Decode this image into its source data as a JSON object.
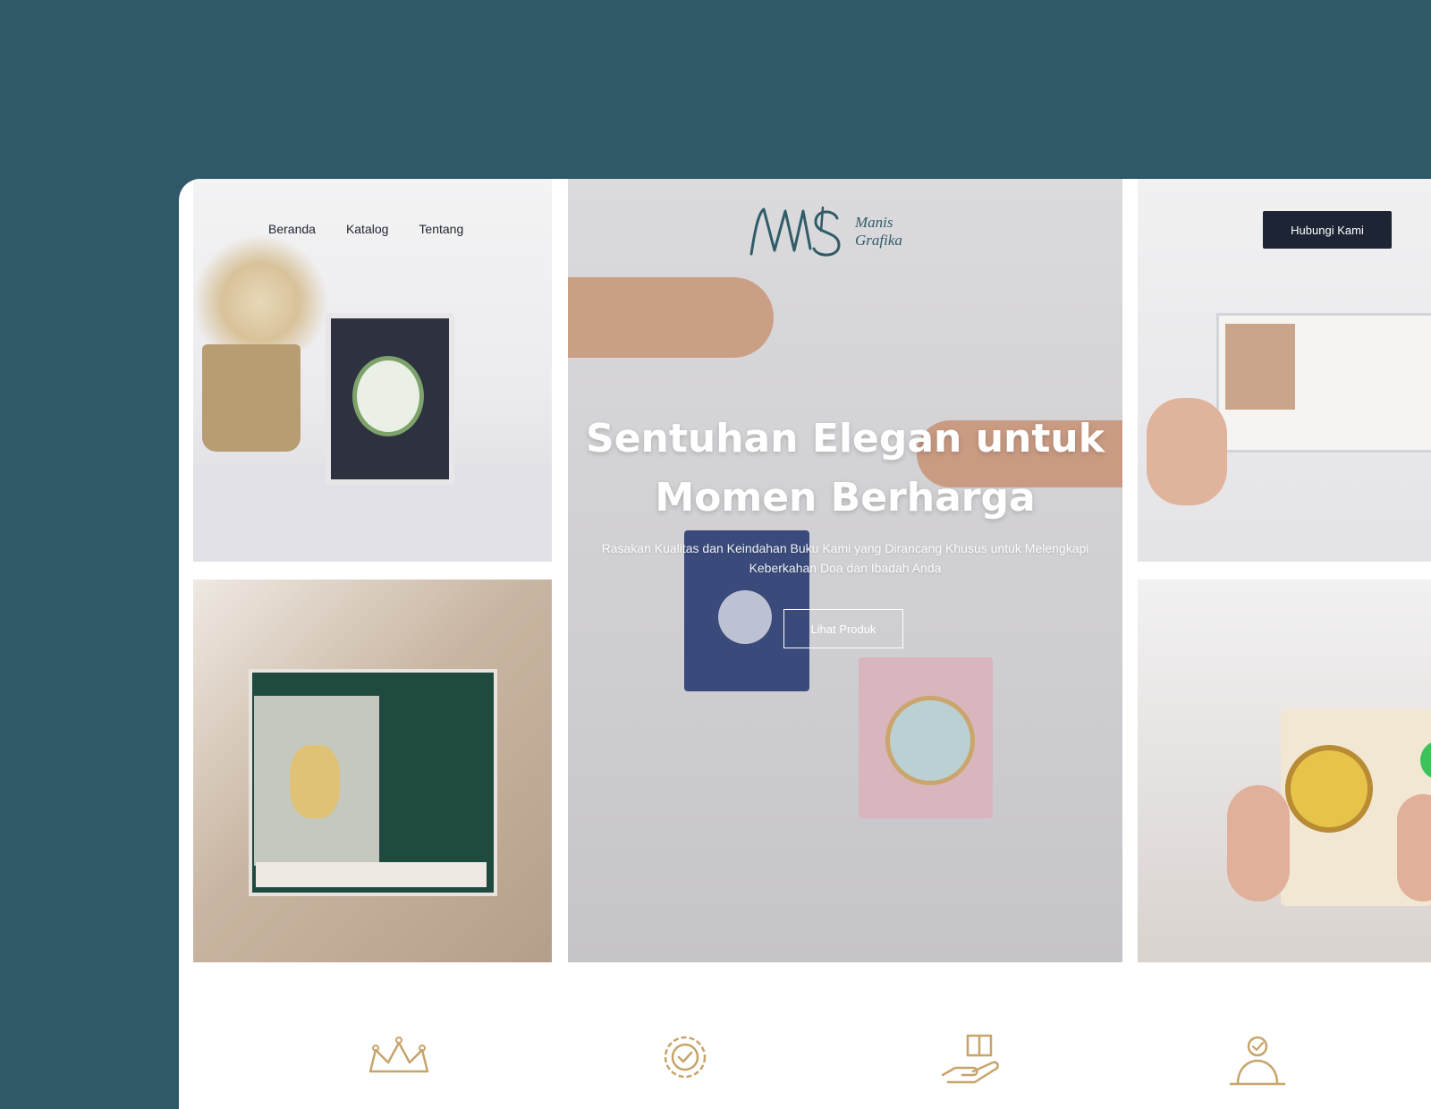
{
  "nav": {
    "items": [
      {
        "label": "Beranda"
      },
      {
        "label": "Katalog"
      },
      {
        "label": "Tentang"
      }
    ]
  },
  "brand": {
    "line1": "Manis",
    "line2": "Grafika",
    "color": "#2f5c68"
  },
  "header": {
    "contact_label": "Hubungi Kami"
  },
  "hero": {
    "title_line1": "Sentuhan Elegan untuk",
    "title_line2": "Momen Berharga",
    "subtitle": "Rasakan Kualitas dan Keindahan Buku Kami yang Dirancang Khusus untuk Melengkapi Keberkahan Doa dan Ibadah Anda",
    "button_label": "Lihat Produk"
  },
  "features": {
    "icons": [
      "crown-icon",
      "badge-check-icon",
      "hand-gift-icon",
      "person-check-icon"
    ],
    "icon_color": "#c6a46a"
  },
  "colors": {
    "page_background": "#305968",
    "button_dark": "#1d2535",
    "accent_gold": "#c6a46a"
  }
}
